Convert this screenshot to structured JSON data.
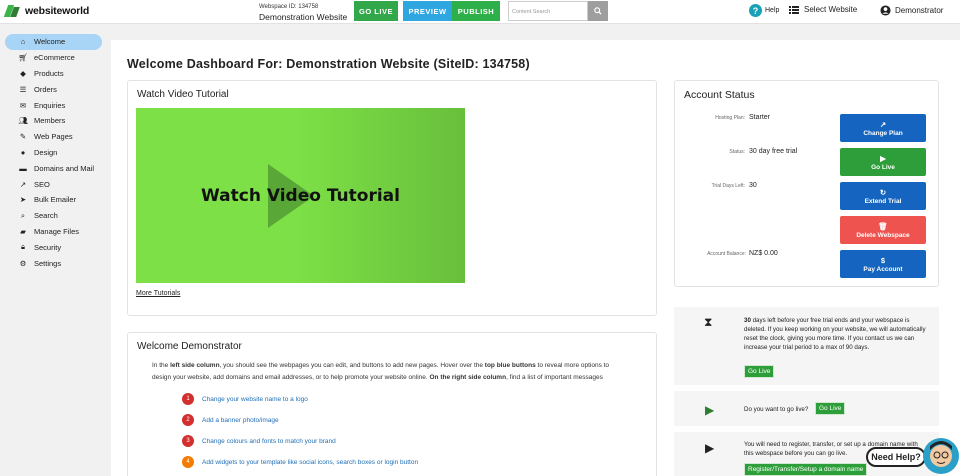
{
  "header": {
    "logo_text": "websiteworld",
    "site_id": "Webspace ID: 134758",
    "site_name": "Demonstration Website",
    "go_live": "GO LIVE",
    "preview": "PREVIEW",
    "publish": "PUBLISH",
    "search_placeholder": "Content Search",
    "help": "Help",
    "select_website": "Select Website",
    "user": "Demonstrator",
    "colors": {
      "go_live": "#33a84a",
      "preview": "#2ea7e0",
      "publish": "#2db04a"
    }
  },
  "sidebar": {
    "items": [
      {
        "label": "Welcome",
        "icon": "home-icon"
      },
      {
        "label": "eCommerce",
        "icon": "cart-icon"
      },
      {
        "label": "Products",
        "icon": "tag-icon"
      },
      {
        "label": "Orders",
        "icon": "list-icon"
      },
      {
        "label": "Enquiries",
        "icon": "envelope-icon"
      },
      {
        "label": "Members",
        "icon": "users-icon"
      },
      {
        "label": "Web Pages",
        "icon": "pencil-icon"
      },
      {
        "label": "Design",
        "icon": "palette-icon"
      },
      {
        "label": "Domains and Mail",
        "icon": "server-icon"
      },
      {
        "label": "SEO",
        "icon": "chart-line-icon"
      },
      {
        "label": "Bulk Emailer",
        "icon": "send-icon"
      },
      {
        "label": "Search",
        "icon": "search-icon"
      },
      {
        "label": "Manage Files",
        "icon": "folder-icon"
      },
      {
        "label": "Security",
        "icon": "lock-icon"
      },
      {
        "label": "Settings",
        "icon": "gear-icon"
      }
    ]
  },
  "main": {
    "title": "Welcome Dashboard For: Demonstration Website (SiteID: 134758)",
    "video": {
      "title": "Watch Video Tutorial",
      "thumb_text": "Watch Video Tutorial",
      "more_link": "More Tutorials"
    },
    "account": {
      "title": "Account Status",
      "rows": [
        {
          "label": "Hosting Plan:",
          "value": "Starter",
          "button": "Change Plan",
          "color": "#1565c0"
        },
        {
          "label": "Status:",
          "value": "30 day free trial",
          "button": "Go Live",
          "color": "#2e9e3a"
        },
        {
          "label": "Trial Days Left:",
          "value": "30",
          "button": "Extend Trial",
          "color": "#1565c0"
        },
        {
          "label": "",
          "value": "",
          "button": "Delete Webspace",
          "color": "#ef5350"
        },
        {
          "label": "Account Balance:",
          "value": "NZ$ 0.00",
          "button": "Pay Account",
          "color": "#1565c0"
        }
      ]
    },
    "welcome": {
      "title": "Welcome Demonstrator",
      "p1_a": "In the ",
      "p1_b": "left side column",
      "p1_c": ", you should see the webpages you can edit, and buttons to add new pages. Hover over the ",
      "p1_d": "top blue buttons",
      "p1_e": " to reveal more options to",
      "p2_a": "design your website, add domains and email addresses, or to help promote your website online. ",
      "p2_b": "On the right side column",
      "p2_c": ", find a list of important messages",
      "steps": [
        {
          "num": "1",
          "text": "Change your website name to a logo",
          "color": "#d32f2f"
        },
        {
          "num": "2",
          "text": "Add a banner photo/image",
          "color": "#d32f2f"
        },
        {
          "num": "3",
          "text": "Change colours and fonts to match your brand",
          "color": "#d32f2f"
        },
        {
          "num": "4",
          "text": "Add widgets to your template like social icons, search boxes or login button",
          "color": "#f57c00"
        }
      ]
    },
    "messages": {
      "m1_days": "30",
      "m1_text": " days left before your free trial ends and your webspace is deleted. If you keep working on your website, we will automatically reset the clock, giving you more time. If you contact us we can increase your trial period to a max of 90 days.",
      "m1_button": "Go Live",
      "m2_text": "Do you want to go live?",
      "m2_button": "Go Live",
      "m3_text": "You will need to register, transfer, or set up a domain name with this webspace before you can go live.",
      "m3_button": "Register/Transfer/Setup a domain name",
      "need_help": "Need Help?"
    }
  }
}
